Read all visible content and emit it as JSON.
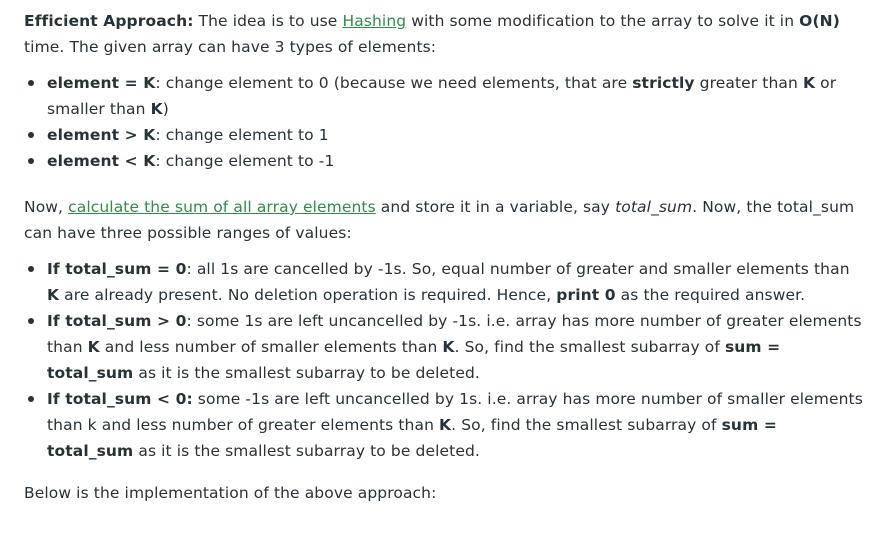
{
  "intro": {
    "label": "Efficient Approach:",
    "text1": " The idea is to use ",
    "link": "Hashing",
    "text2": " with some modification to the array to solve it in ",
    "complexity": "O(N)",
    "text3": " time. The given array can have 3 types of elements:"
  },
  "types": [
    {
      "cond": "element = K",
      "text1": ": change element to 0 (because we need elements, that are ",
      "bold1": "strictly",
      "text2": " greater than ",
      "bold2": "K",
      "text3": " or smaller than ",
      "bold3": "K",
      "text4": ")"
    },
    {
      "cond": "element > K",
      "text1": ": change element to 1"
    },
    {
      "cond": "element < K",
      "text1": ": change element to -1"
    }
  ],
  "now": {
    "text1": "Now, ",
    "link": "calculate the sum of all array elements",
    "text2": " and store it in a variable, say ",
    "var": "total_sum",
    "text3": ". Now, the total_sum can have three possible ranges of values:"
  },
  "cases": [
    {
      "cond": "If total_sum = 0",
      "text1": ": all 1s are cancelled by -1s. So, equal number of greater and smaller elements than ",
      "bold1": "K",
      "text2": " are already present. No deletion operation is required. Hence, ",
      "bold2": "print 0",
      "text3": " as the required answer."
    },
    {
      "cond": "If total_sum > 0",
      "text1": ": some 1s are left uncancelled by -1s. i.e. array has more number of greater elements than ",
      "bold1": "K",
      "text2": " and less number of smaller elements than ",
      "bold2": "K",
      "text3": ". So, find the smallest subarray of ",
      "bold3": "sum = total_sum",
      "text4": " as it is the smallest subarray to be deleted."
    },
    {
      "cond": "If total_sum < 0:",
      "text1": " some -1s are left uncancelled by 1s. i.e. array has more number of smaller elements than k and less number of greater elements than ",
      "bold1": "K",
      "text2": ". So, find the smallest subarray of ",
      "bold2": "sum = total_sum",
      "text3": " as it is the smallest subarray to be deleted."
    }
  ],
  "footer": {
    "text": "Below is the implementation of the above approach:"
  }
}
